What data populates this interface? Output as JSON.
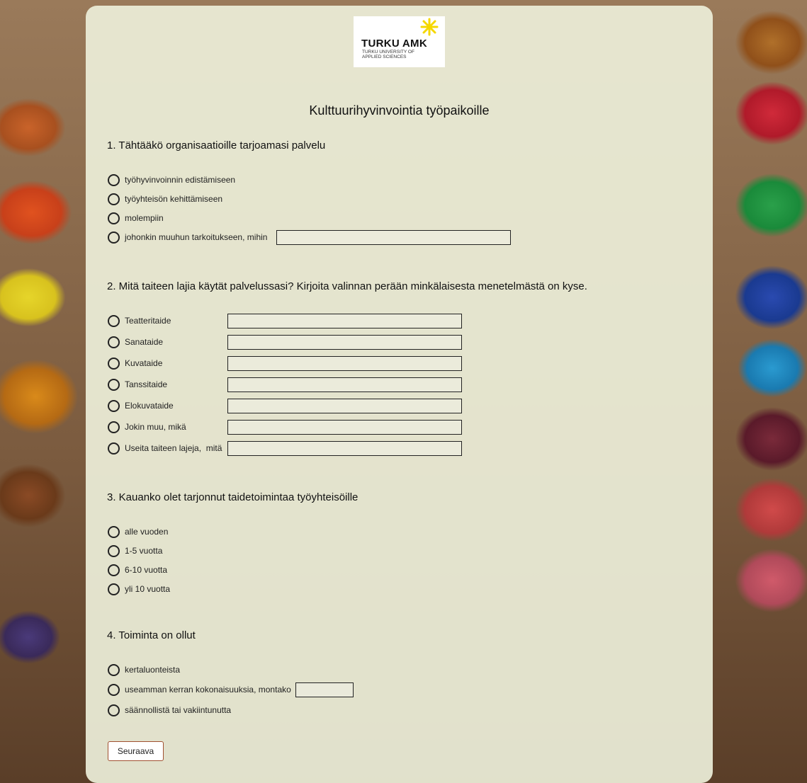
{
  "logo": {
    "title": "TURKU AMK",
    "subtitle": "TURKU UNIVERSITY OF APPLIED SCIENCES"
  },
  "page_title": "Kulttuurihyvinvointia työpaikoille",
  "q1": {
    "title": "1. Tähtääkö organisaatioille tarjoamasi palvelu",
    "options": [
      "työhyvinvoinnin edistämiseen",
      "työyhteisön kehittämiseen",
      "molempiin",
      "johonkin muuhun tarkoitukseen, mihin"
    ],
    "other_value": ""
  },
  "q2": {
    "title": "2. Mitä taiteen lajia käytät palvelussasi? Kirjoita valinnan perään minkälaisesta menetelmästä on kyse.",
    "options": [
      "Teatteritaide",
      "Sanataide",
      "Kuvataide",
      "Tanssitaide",
      "Elokuvataide",
      "Jokin muu, mikä",
      "Useita taiteen lajeja,  mitä"
    ]
  },
  "q3": {
    "title": "3. Kauanko olet tarjonnut taidetoimintaa työyhteisöille",
    "options": [
      "alle vuoden",
      "1-5 vuotta",
      "6-10 vuotta",
      "yli 10 vuotta"
    ]
  },
  "q4": {
    "title": "4. Toiminta on ollut",
    "options": [
      "kertaluonteista",
      "useamman kerran kokonaisuuksia, montako",
      "säännollistä tai vakiintunutta"
    ]
  },
  "next_label": "Seuraava",
  "colors": {
    "panel": "#ecEED8",
    "logo_star": "#f5d800",
    "button_border": "#a05030"
  }
}
